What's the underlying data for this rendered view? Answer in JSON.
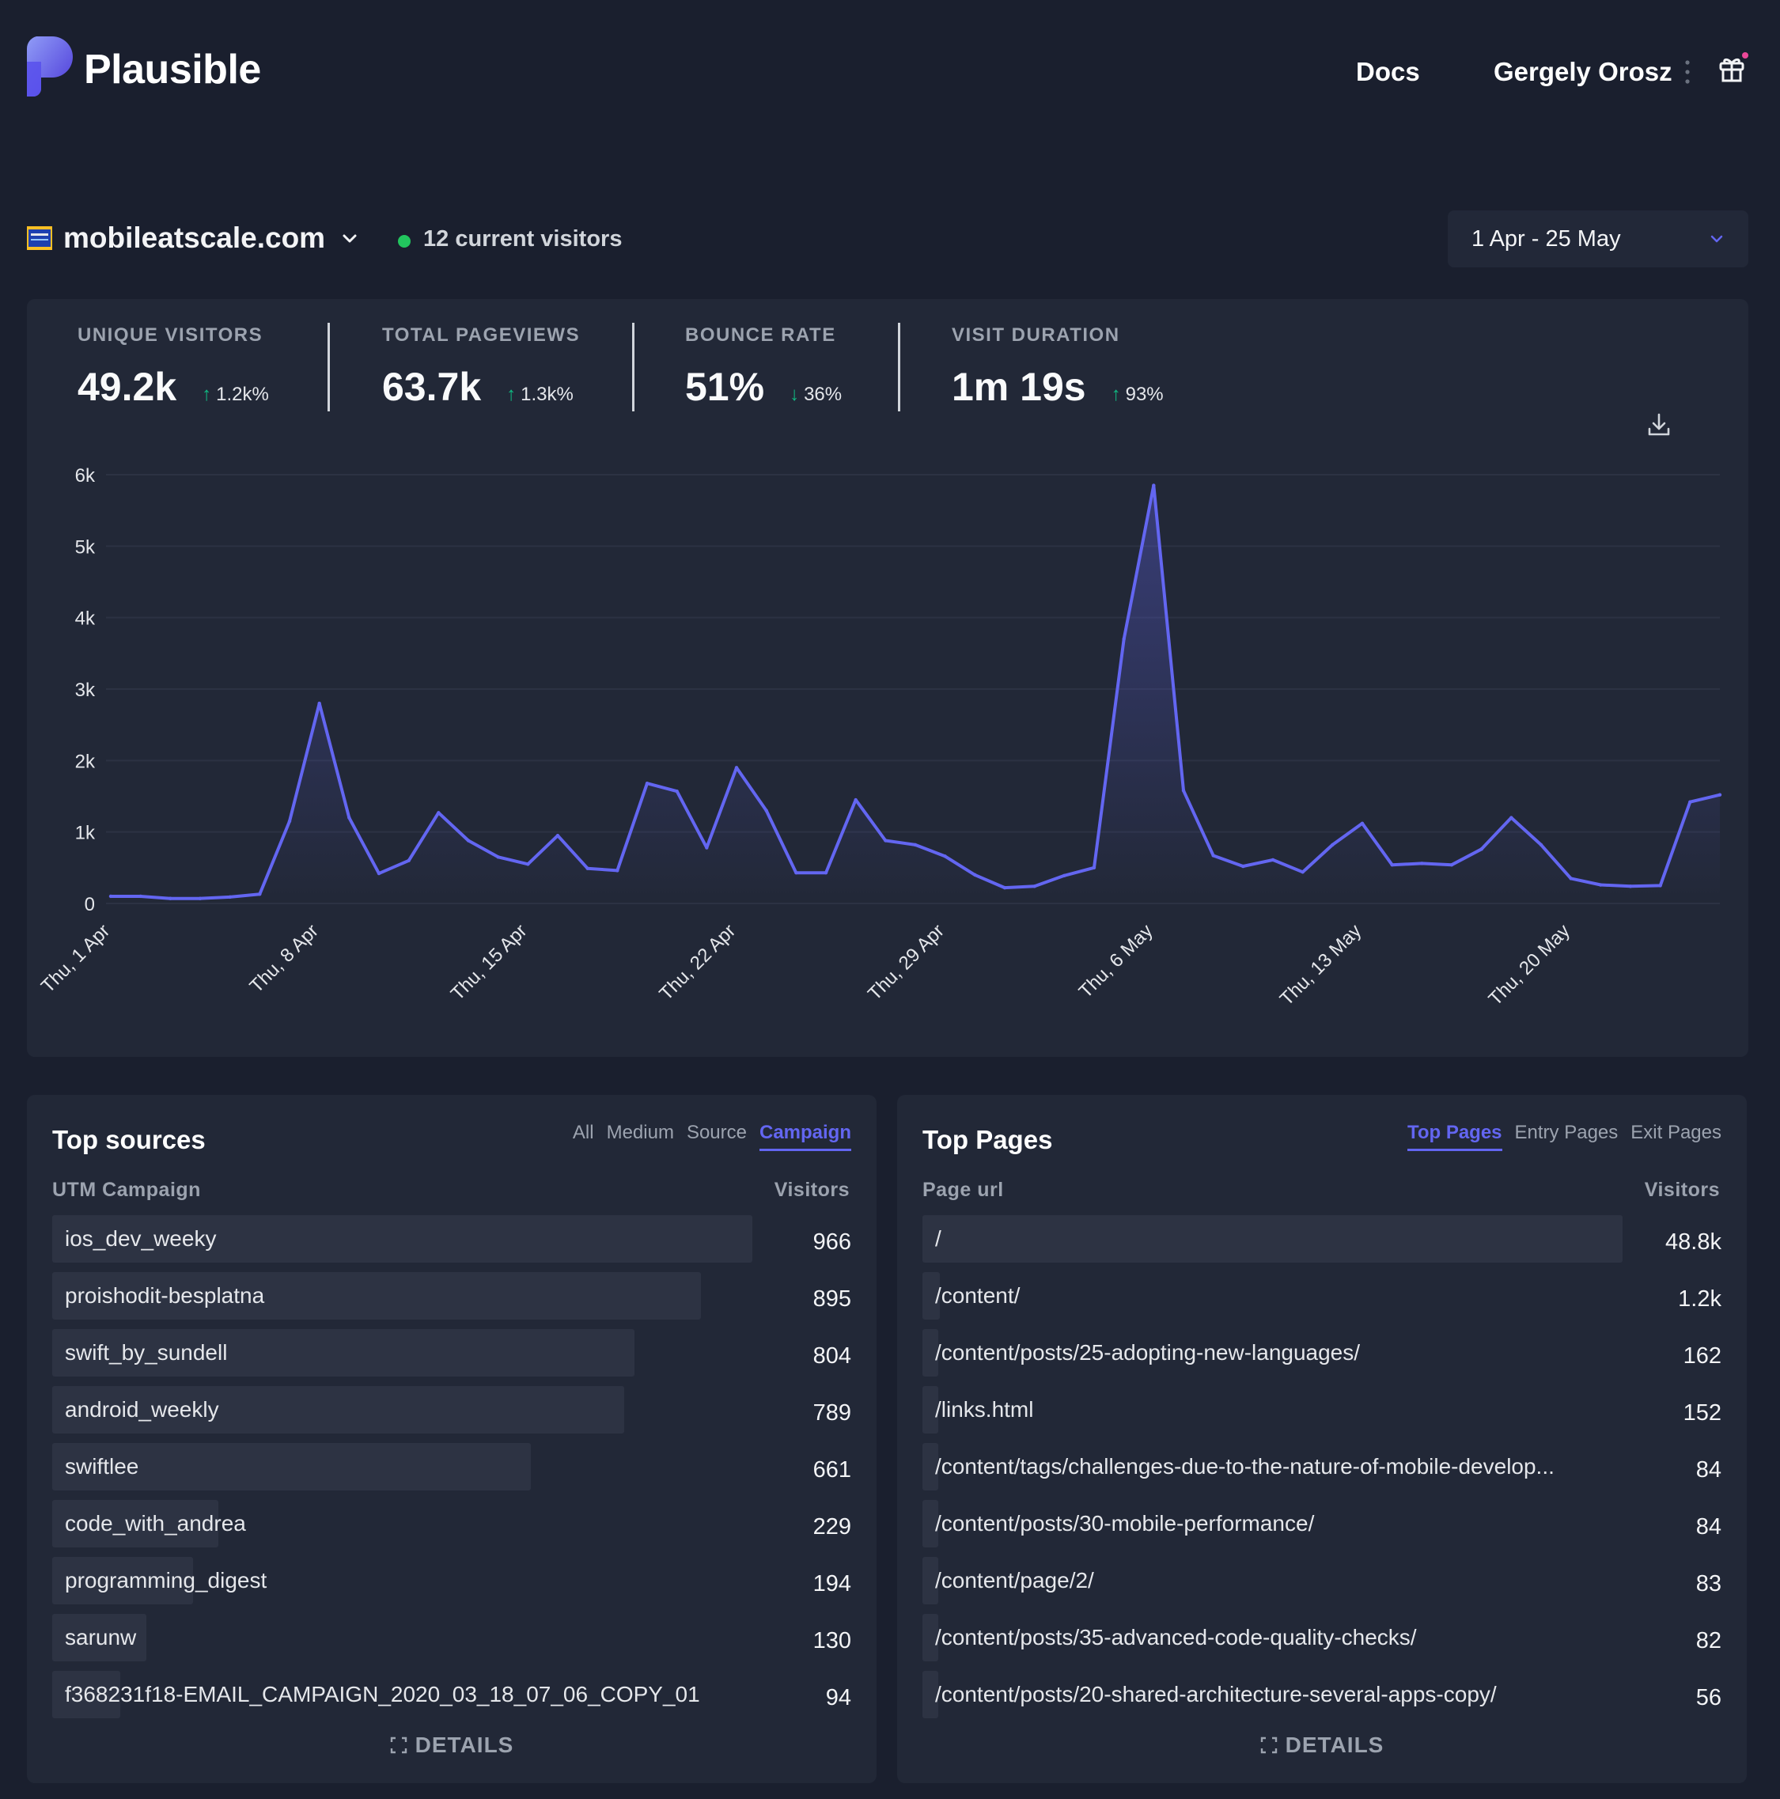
{
  "header": {
    "brand": "Plausible",
    "nav_docs": "Docs",
    "user_name": "Gergely Orosz"
  },
  "site": {
    "name": "mobileatscale.com",
    "live_visitors": "12 current visitors",
    "date_range": "1 Apr - 25 May"
  },
  "stats": [
    {
      "label": "UNIQUE VISITORS",
      "value": "49.2k",
      "change": "1.2k%",
      "direction": "up"
    },
    {
      "label": "TOTAL PAGEVIEWS",
      "value": "63.7k",
      "change": "1.3k%",
      "direction": "up"
    },
    {
      "label": "BOUNCE RATE",
      "value": "51%",
      "change": "36%",
      "direction": "down"
    },
    {
      "label": "VISIT DURATION",
      "value": "1m 19s",
      "change": "93%",
      "direction": "up"
    }
  ],
  "chart_data": {
    "type": "area",
    "ylim": [
      0,
      6000
    ],
    "y_ticks": [
      "0",
      "1k",
      "2k",
      "3k",
      "4k",
      "5k",
      "6k"
    ],
    "x_tick_labels": [
      "Thu, 1 Apr",
      "Thu, 8 Apr",
      "Thu, 15 Apr",
      "Thu, 22 Apr",
      "Thu, 29 Apr",
      "Thu, 6 May",
      "Thu, 13 May",
      "Thu, 20 May"
    ],
    "x_tick_day_index": [
      0,
      7,
      14,
      21,
      28,
      35,
      42,
      49
    ],
    "grid": true,
    "line_color": "#6366f1",
    "values": [
      100,
      100,
      70,
      70,
      90,
      130,
      1150,
      2800,
      1200,
      420,
      600,
      1270,
      880,
      650,
      550,
      950,
      490,
      460,
      1680,
      1570,
      780,
      1900,
      1300,
      430,
      430,
      1450,
      880,
      820,
      660,
      400,
      220,
      240,
      390,
      500,
      3700,
      5850,
      1580,
      670,
      520,
      610,
      440,
      820,
      1120,
      540,
      560,
      540,
      760,
      1200,
      820,
      350,
      260,
      240,
      250,
      1420,
      1520
    ]
  },
  "top_sources": {
    "title": "Top sources",
    "tabs": [
      "All",
      "Medium",
      "Source",
      "Campaign"
    ],
    "active_tab": "Campaign",
    "col_label": "UTM Campaign",
    "col_value": "Visitors",
    "rows": [
      {
        "label": "ios_dev_weeky",
        "value": "966",
        "ratio": 1.0
      },
      {
        "label": "proishodit-besplatna",
        "value": "895",
        "ratio": 0.926
      },
      {
        "label": "swift_by_sundell",
        "value": "804",
        "ratio": 0.832
      },
      {
        "label": "android_weekly",
        "value": "789",
        "ratio": 0.817
      },
      {
        "label": "swiftlee",
        "value": "661",
        "ratio": 0.684
      },
      {
        "label": "code_with_andrea",
        "value": "229",
        "ratio": 0.237
      },
      {
        "label": "programming_digest",
        "value": "194",
        "ratio": 0.201
      },
      {
        "label": "sarunw",
        "value": "130",
        "ratio": 0.135
      },
      {
        "label": "f368231f18-EMAIL_CAMPAIGN_2020_03_18_07_06_COPY_01",
        "value": "94",
        "ratio": 0.097
      }
    ],
    "details": "DETAILS"
  },
  "top_pages": {
    "title": "Top Pages",
    "tabs": [
      "Top Pages",
      "Entry Pages",
      "Exit Pages"
    ],
    "active_tab": "Top Pages",
    "col_label": "Page url",
    "col_value": "Visitors",
    "rows": [
      {
        "label": "/",
        "value": "48.8k",
        "ratio": 1.0
      },
      {
        "label": "/content/",
        "value": "1.2k",
        "ratio": 0.025
      },
      {
        "label": "/content/posts/25-adopting-new-languages/",
        "value": "162",
        "ratio": 0.0033
      },
      {
        "label": "/links.html",
        "value": "152",
        "ratio": 0.0031
      },
      {
        "label": "/content/tags/challenges-due-to-the-nature-of-mobile-develop...",
        "value": "84",
        "ratio": 0.0017
      },
      {
        "label": "/content/posts/30-mobile-performance/",
        "value": "84",
        "ratio": 0.0017
      },
      {
        "label": "/content/page/2/",
        "value": "83",
        "ratio": 0.0017
      },
      {
        "label": "/content/posts/35-advanced-code-quality-checks/",
        "value": "82",
        "ratio": 0.0017
      },
      {
        "label": "/content/posts/20-shared-architecture-several-apps-copy/",
        "value": "56",
        "ratio": 0.0011
      }
    ],
    "details": "DETAILS"
  }
}
